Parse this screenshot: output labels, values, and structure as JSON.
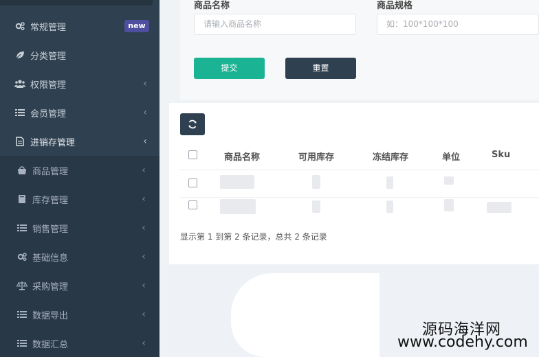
{
  "sidebar": {
    "items": [
      {
        "label": "常规管理",
        "icon": "gears-icon",
        "badge": "new"
      },
      {
        "label": "分类管理",
        "icon": "leaf-icon"
      },
      {
        "label": "权限管理",
        "icon": "users-icon"
      },
      {
        "label": "会员管理",
        "icon": "list-icon"
      },
      {
        "label": "进销存管理",
        "icon": "file-icon"
      }
    ],
    "submenu": [
      {
        "label": "商品管理",
        "icon": "shopping-bag-icon"
      },
      {
        "label": "库存管理",
        "icon": "book-icon"
      },
      {
        "label": "销售管理",
        "icon": "list-icon"
      },
      {
        "label": "基础信息",
        "icon": "gears-icon"
      },
      {
        "label": "采购管理",
        "icon": "balance-scale-icon"
      },
      {
        "label": "数据导出",
        "icon": "list-icon"
      },
      {
        "label": "数据汇总",
        "icon": "list-icon"
      }
    ]
  },
  "search": {
    "name_label": "商品名称",
    "name_placeholder": "请输入商品名称",
    "spec_label": "商品规格",
    "spec_placeholder": "如：100*100*100",
    "submit_label": "提交",
    "reset_label": "重置"
  },
  "table": {
    "columns": [
      "商品名称",
      "可用库存",
      "冻结库存",
      "单位",
      "Sku"
    ],
    "pager": "显示第 1 到第 2 条记录，总共 2 条记录"
  },
  "watermark": {
    "name": "源码海洋网",
    "url": "www.codehy.com"
  },
  "colors": {
    "sidebar": "#2f4050",
    "submit": "#1ab394",
    "badge": "#4e4f9e"
  }
}
